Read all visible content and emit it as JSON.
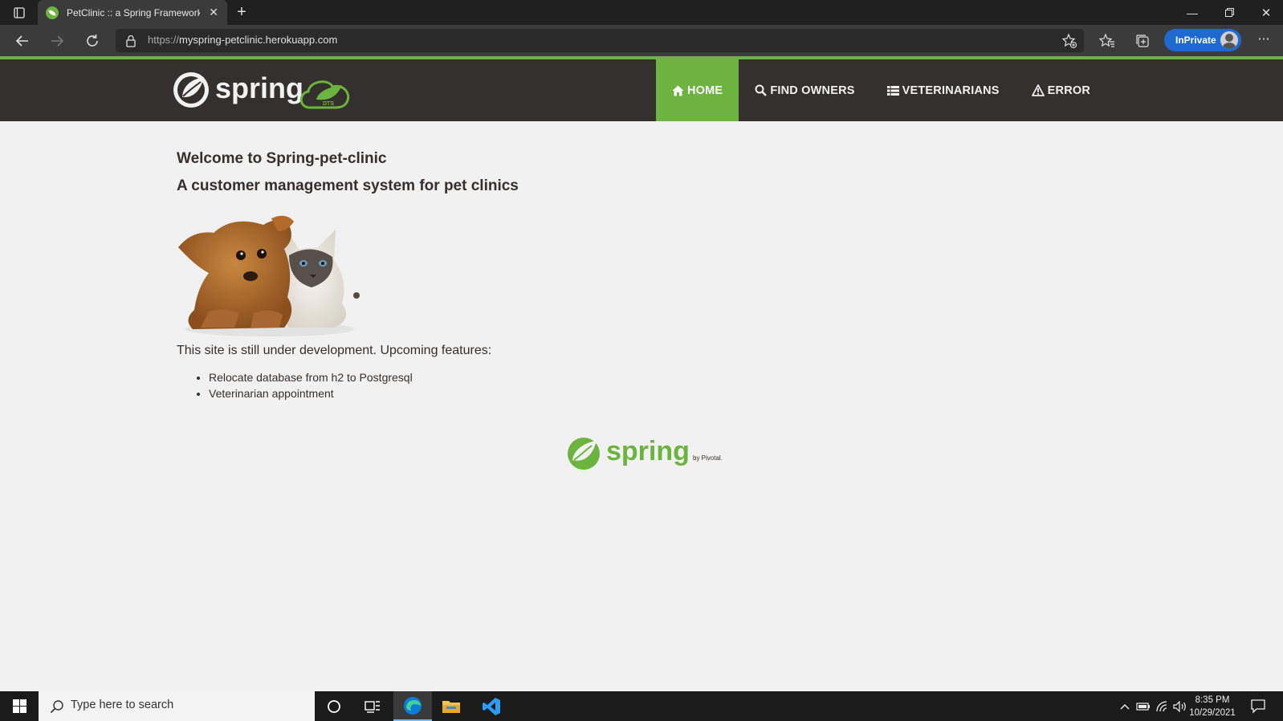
{
  "browser": {
    "tab_title": "PetClinic :: a Spring Framework demonstration",
    "tab_close": "✕",
    "new_tab": "+",
    "url_prefix": "https://",
    "url_host": "myspring-petclinic.herokuapp.com",
    "inprivate_label": "InPrivate",
    "more": "···",
    "win_min": "—",
    "win_close": "✕"
  },
  "site": {
    "brand_text": "spring",
    "brand_badge": "DTS",
    "nav": [
      {
        "label": "HOME",
        "icon": "home-icon",
        "active": true
      },
      {
        "label": "FIND OWNERS",
        "icon": "search-icon",
        "active": false
      },
      {
        "label": "VETERINARIANS",
        "icon": "list-icon",
        "active": false
      },
      {
        "label": "ERROR",
        "icon": "warning-icon",
        "active": false
      }
    ],
    "accent": "#6db33f",
    "navbar_bg": "#34302d"
  },
  "main": {
    "welcome": "Welcome to Spring-pet-clinic",
    "subtitle": "A customer management system for pet clinics",
    "dev_note": "This site is still under development. Upcoming features:",
    "features": [
      "Relocate database from h2 to Postgresql",
      "Veterinarian appointment"
    ]
  },
  "footer": {
    "logo_text": "spring",
    "by_text": "by Pivotal."
  },
  "taskbar": {
    "search_placeholder": "Type here to search",
    "time": "8:35 PM",
    "date": "10/29/2021"
  }
}
